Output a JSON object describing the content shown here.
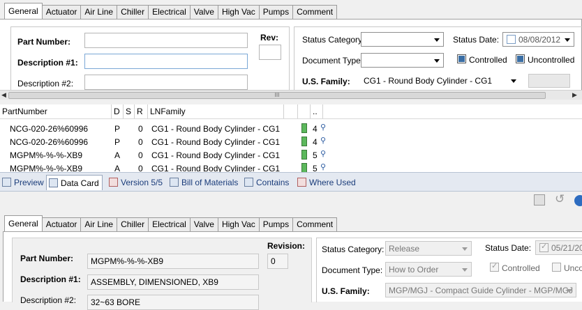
{
  "top_tabs": [
    "General",
    "Actuator",
    "Air Line",
    "Chiller",
    "Electrical",
    "Valve",
    "High Vac",
    "Pumps",
    "Comment"
  ],
  "top_form": {
    "part_number_label": "Part Number:",
    "description1_label": "Description #1:",
    "description2_label": "Description #2:",
    "rev_label": "Rev:",
    "status_category_label": "Status Category:",
    "document_type_label": "Document Type:",
    "us_family_label": "U.S. Family:",
    "status_date_label": "Status Date:",
    "status_date_value": "08/08/2012",
    "controlled_label": "Controlled",
    "uncontrolled_label": "Uncontrolled",
    "us_family_value": "CG1 - Round Body Cylinder - CG1"
  },
  "grid": {
    "headers": [
      "PartNumber",
      "D",
      "S",
      "R",
      "LNFamily",
      "",
      ".."
    ],
    "rows": [
      {
        "part": "NCG-020-26%60996",
        "d": "P",
        "r": "0",
        "family": "CG1 - Round Body Cylinder - CG1",
        "n": "4"
      },
      {
        "part": "NCG-020-26%60996",
        "d": "P",
        "r": "0",
        "family": "CG1 - Round Body Cylinder - CG1",
        "n": "4"
      },
      {
        "part": "MGPM%-%-%-XB9",
        "d": "A",
        "r": "0",
        "family": "CG1 - Round Body Cylinder - CG1",
        "n": "5"
      },
      {
        "part": "MGPM%-%-%-XB9",
        "d": "A",
        "r": "0",
        "family": "CG1 - Round Body Cylinder - CG1",
        "n": "5"
      }
    ]
  },
  "bottom_tabs": [
    "Preview",
    "Data Card",
    "Version 5/5",
    "Bill of Materials",
    "Contains",
    "Where Used"
  ],
  "card_tabs": [
    "General",
    "Actuator",
    "Air Line",
    "Chiller",
    "Electrical",
    "Valve",
    "High Vac",
    "Pumps",
    "Comment"
  ],
  "card_form": {
    "part_number_label": "Part Number:",
    "part_number_value": "MGPM%-%-%-XB9",
    "description1_label": "Description #1:",
    "description1_value": "ASSEMBLY, DIMENSIONED, XB9",
    "description2_label": "Description #2:",
    "description2_value": "32~63 BORE",
    "revision_label": "Revision:",
    "revision_value": "0",
    "status_category_label": "Status Category:",
    "status_category_value": "Release",
    "document_type_label": "Document Type:",
    "document_type_value": "How to Order",
    "us_family_label": "U.S. Family:",
    "us_family_value": "MGP/MGJ - Compact Guide Cylinder - MGP/MGJ",
    "status_date_label": "Status Date:",
    "status_date_value": "05/21/20",
    "controlled_label": "Controlled",
    "uncontrolled_label": "Unco"
  },
  "scroll_grip": "III"
}
